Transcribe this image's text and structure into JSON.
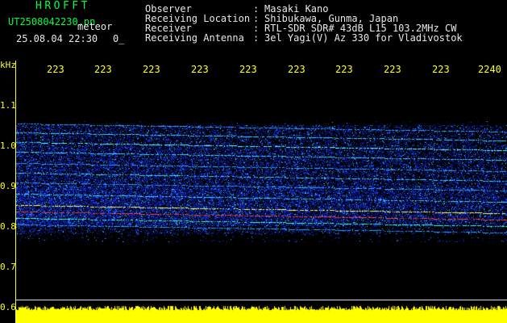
{
  "header": {
    "app_title": "HROFFT",
    "filename": "UT2508042230.pn",
    "mode": "meteor",
    "datetime": "25.08.04 22:30",
    "count": "0_"
  },
  "info": [
    {
      "label": "Observer",
      "value": "Masaki Kano"
    },
    {
      "label": "Receiving Location",
      "value": "Shibukawa, Gunma, Japan"
    },
    {
      "label": "Receiver",
      "value": "RTL-SDR SDR# 43dB L15 103.2MHz CW"
    },
    {
      "label": "Receiving Antenna",
      "value": "3el Yagi(V) Az 330 for Vladivostok"
    }
  ],
  "info_separator": ":",
  "axis": {
    "unit": "kHz",
    "time_ticks": [
      "223",
      "223",
      "223",
      "223",
      "223",
      "223",
      "223",
      "223",
      "223",
      "2240"
    ],
    "freq_ticks": [
      "1.1",
      "1.0",
      "0.9",
      "0.8",
      "0.7",
      "0.6"
    ]
  },
  "colors": {
    "info_text": "#e8e8e8",
    "title_green": "#00ff40",
    "axis_yellow": "#ffff20",
    "signal_blue": "#1a3cff",
    "signal_red": "#ff3020",
    "power_yellow": "#ffff00"
  }
}
